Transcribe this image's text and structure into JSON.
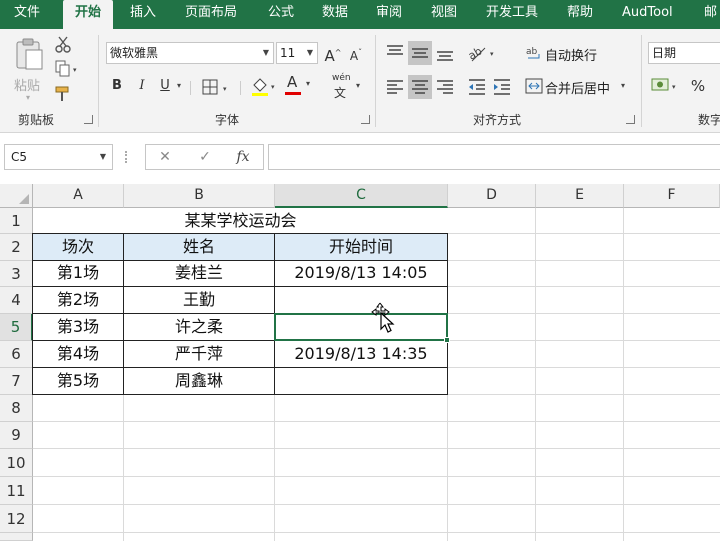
{
  "ribbon": {
    "tabs": [
      "文件",
      "开始",
      "插入",
      "页面布局",
      "公式",
      "数据",
      "审阅",
      "视图",
      "开发工具",
      "帮助",
      "AudTool",
      "邮"
    ],
    "active_tab": "开始",
    "clipboard": {
      "paste_label": "粘贴",
      "group_label": "剪贴板"
    },
    "font": {
      "name": "微软雅黑",
      "size": "11",
      "group_label": "字体",
      "grow_label": "A",
      "shrink_label": "A",
      "bold": "B",
      "italic": "I",
      "underline": "U",
      "font_color_label": "A",
      "phonetic_top": "wén",
      "phonetic_bottom": "文"
    },
    "alignment": {
      "wrap_label": "自动换行",
      "merge_label": "合并后居中",
      "group_label": "对齐方式"
    },
    "number": {
      "format": "日期",
      "percent": "%",
      "group_label": "数字"
    }
  },
  "formula_bar": {
    "name_box": "C5",
    "cancel": "✕",
    "enter": "✓",
    "fx": "fx",
    "content": ""
  },
  "grid": {
    "columns": [
      "A",
      "B",
      "C",
      "D",
      "E",
      "F"
    ],
    "rows": [
      "1",
      "2",
      "3",
      "4",
      "5",
      "6",
      "7",
      "8",
      "9",
      "10",
      "11",
      "12"
    ],
    "active_cell": "C5",
    "title": "某某学校运动会",
    "headers": [
      "场次",
      "姓名",
      "开始时间"
    ],
    "data_rows": [
      [
        "第1场",
        "姜桂兰",
        "2019/8/13 14:05"
      ],
      [
        "第2场",
        "王勤",
        ""
      ],
      [
        "第3场",
        "许之柔",
        ""
      ],
      [
        "第4场",
        "严千萍",
        "2019/8/13 14:35"
      ],
      [
        "第5场",
        "周鑫琳",
        ""
      ]
    ]
  },
  "colors": {
    "accent": "#217346",
    "header_fill": "#DDEBF7"
  }
}
